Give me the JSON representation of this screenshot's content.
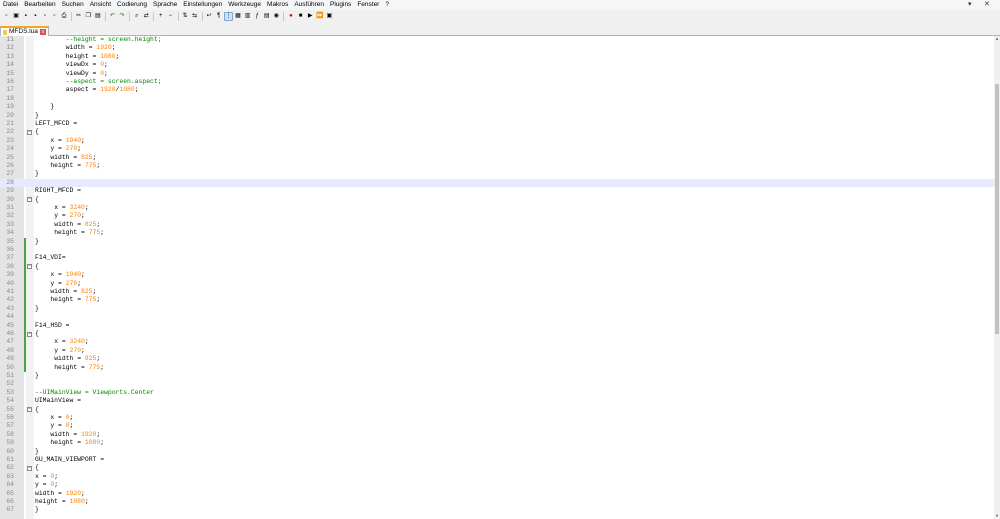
{
  "menu": [
    "Datei",
    "Bearbeiten",
    "Suchen",
    "Ansicht",
    "Codierung",
    "Sprache",
    "Einstellungen",
    "Werkzeuge",
    "Makros",
    "Ausführen",
    "Plugins",
    "Fenster",
    "?"
  ],
  "window_controls": {
    "pin": "▾",
    "close": "✕"
  },
  "toolbar": [
    {
      "name": "new-file-icon",
      "glyph": "▫"
    },
    {
      "name": "open-file-icon",
      "glyph": "▣"
    },
    {
      "name": "save-icon",
      "glyph": "▪"
    },
    {
      "name": "save-all-icon",
      "glyph": "▪"
    },
    {
      "name": "close-file-icon",
      "glyph": "▫"
    },
    {
      "name": "close-all-icon",
      "glyph": "▫"
    },
    {
      "name": "print-icon",
      "glyph": "⎙"
    },
    {
      "sep": true
    },
    {
      "name": "cut-icon",
      "glyph": "✂"
    },
    {
      "name": "copy-icon",
      "glyph": "❐"
    },
    {
      "name": "paste-icon",
      "glyph": "▤"
    },
    {
      "sep": true
    },
    {
      "name": "undo-icon",
      "glyph": "↶"
    },
    {
      "name": "redo-icon",
      "glyph": "↷"
    },
    {
      "sep": true
    },
    {
      "name": "find-icon",
      "glyph": "⌕"
    },
    {
      "name": "replace-icon",
      "glyph": "⇄"
    },
    {
      "sep": true
    },
    {
      "name": "zoom-in-icon",
      "glyph": "+"
    },
    {
      "name": "zoom-out-icon",
      "glyph": "−"
    },
    {
      "sep": true
    },
    {
      "name": "sync-vertical-icon",
      "glyph": "⇅"
    },
    {
      "name": "sync-horizontal-icon",
      "glyph": "⇆"
    },
    {
      "sep": true
    },
    {
      "name": "word-wrap-icon",
      "glyph": "↵"
    },
    {
      "name": "show-all-chars-icon",
      "glyph": "¶"
    },
    {
      "name": "indent-guide-icon",
      "glyph": "⋮",
      "active": true
    },
    {
      "name": "lang-define-icon",
      "glyph": "▦"
    },
    {
      "name": "doc-map-icon",
      "glyph": "▥"
    },
    {
      "name": "function-list-icon",
      "glyph": "ƒ"
    },
    {
      "name": "folder-workspace-icon",
      "glyph": "▤"
    },
    {
      "name": "monitoring-icon",
      "glyph": "◉"
    },
    {
      "sep": true
    },
    {
      "name": "record-macro-icon",
      "glyph": "●"
    },
    {
      "name": "stop-record-icon",
      "glyph": "■"
    },
    {
      "name": "play-macro-icon",
      "glyph": "▶"
    },
    {
      "name": "run-macro-multiple-icon",
      "glyph": "⏩"
    },
    {
      "name": "save-macro-icon",
      "glyph": "▣"
    }
  ],
  "colors": {
    "number": "#ff8000",
    "comment": "#008000",
    "change_marker": "#4aa34a",
    "current_line": "#e8e8ff"
  },
  "tab": {
    "label": "MFDS.lua",
    "close": "x"
  },
  "lines": [
    {
      "n": "11",
      "i": "        ",
      "t": [
        [
          "--height = screen.height;",
          "c"
        ]
      ]
    },
    {
      "n": "12",
      "i": "        ",
      "t": [
        [
          "width = ",
          "i"
        ],
        [
          "1920",
          "n"
        ],
        [
          ";",
          "i"
        ]
      ]
    },
    {
      "n": "13",
      "i": "        ",
      "t": [
        [
          "height = ",
          "i"
        ],
        [
          "1080",
          "n"
        ],
        [
          ";",
          "i"
        ]
      ]
    },
    {
      "n": "14",
      "i": "        ",
      "t": [
        [
          "viewDx = ",
          "i"
        ],
        [
          "0",
          "n"
        ],
        [
          ";",
          "i"
        ]
      ]
    },
    {
      "n": "15",
      "i": "        ",
      "t": [
        [
          "viewDy = ",
          "i"
        ],
        [
          "0",
          "n"
        ],
        [
          ";",
          "i"
        ]
      ]
    },
    {
      "n": "16",
      "i": "        ",
      "t": [
        [
          "--aspect = screen.aspect;",
          "c"
        ]
      ]
    },
    {
      "n": "17",
      "i": "        ",
      "t": [
        [
          "aspect = ",
          "i"
        ],
        [
          "1920",
          "n"
        ],
        [
          "/",
          "i"
        ],
        [
          "1080",
          "n"
        ],
        [
          ";",
          "i"
        ]
      ]
    },
    {
      "n": "18",
      "i": "",
      "t": []
    },
    {
      "n": "19",
      "i": "    ",
      "t": [
        [
          "}",
          "i"
        ]
      ]
    },
    {
      "n": "20",
      "i": "",
      "t": [
        [
          "}",
          "i"
        ]
      ]
    },
    {
      "n": "21",
      "i": "",
      "t": [
        [
          "LEFT_MFCD =",
          "i"
        ]
      ]
    },
    {
      "n": "22",
      "i": "",
      "t": [
        [
          "{",
          "i"
        ]
      ],
      "fold": true
    },
    {
      "n": "23",
      "i": "    ",
      "t": [
        [
          "x = ",
          "i"
        ],
        [
          "1940",
          "n"
        ],
        [
          ";",
          "i"
        ]
      ]
    },
    {
      "n": "24",
      "i": "    ",
      "t": [
        [
          "y = ",
          "i"
        ],
        [
          "270",
          "n"
        ],
        [
          ";",
          "i"
        ]
      ]
    },
    {
      "n": "25",
      "i": "    ",
      "t": [
        [
          "width = ",
          "i"
        ],
        [
          "825",
          "n"
        ],
        [
          ";",
          "i"
        ]
      ]
    },
    {
      "n": "26",
      "i": "    ",
      "t": [
        [
          "height = ",
          "i"
        ],
        [
          "775",
          "n"
        ],
        [
          ";",
          "i"
        ]
      ]
    },
    {
      "n": "27",
      "i": "",
      "t": [
        [
          "}",
          "i"
        ]
      ]
    },
    {
      "n": "28",
      "i": "",
      "t": [],
      "current": true
    },
    {
      "n": "29",
      "i": "",
      "t": [
        [
          "RIGHT_MFCD =",
          "i"
        ]
      ]
    },
    {
      "n": "30",
      "i": "",
      "t": [
        [
          "{",
          "i"
        ]
      ],
      "fold": true
    },
    {
      "n": "31",
      "i": "     ",
      "t": [
        [
          "x = ",
          "i"
        ],
        [
          "3240",
          "n"
        ],
        [
          ";",
          "i"
        ]
      ]
    },
    {
      "n": "32",
      "i": "     ",
      "t": [
        [
          "y = ",
          "i"
        ],
        [
          "270",
          "n"
        ],
        [
          ";",
          "i"
        ]
      ]
    },
    {
      "n": "33",
      "i": "     ",
      "t": [
        [
          "width = ",
          "i"
        ],
        [
          "825",
          "n"
        ],
        [
          ";",
          "i"
        ]
      ]
    },
    {
      "n": "34",
      "i": "     ",
      "t": [
        [
          "height = ",
          "i"
        ],
        [
          "775",
          "n"
        ],
        [
          ";",
          "i"
        ]
      ]
    },
    {
      "n": "35",
      "i": "",
      "t": [
        [
          "}",
          "i"
        ]
      ],
      "chg": true
    },
    {
      "n": "36",
      "i": "",
      "t": [],
      "chg": true
    },
    {
      "n": "37",
      "i": "",
      "t": [
        [
          "F14_VDI=",
          "i"
        ]
      ],
      "chg": true
    },
    {
      "n": "38",
      "i": "",
      "t": [
        [
          "{",
          "i"
        ]
      ],
      "fold": true,
      "chg": true
    },
    {
      "n": "39",
      "i": "    ",
      "t": [
        [
          "x = ",
          "i"
        ],
        [
          "1940",
          "n"
        ],
        [
          ";",
          "i"
        ]
      ],
      "chg": true
    },
    {
      "n": "40",
      "i": "    ",
      "t": [
        [
          "y = ",
          "i"
        ],
        [
          "270",
          "n"
        ],
        [
          ";",
          "i"
        ]
      ],
      "chg": true
    },
    {
      "n": "41",
      "i": "    ",
      "t": [
        [
          "width = ",
          "i"
        ],
        [
          "825",
          "n"
        ],
        [
          ";",
          "i"
        ]
      ],
      "chg": true
    },
    {
      "n": "42",
      "i": "    ",
      "t": [
        [
          "height = ",
          "i"
        ],
        [
          "775",
          "n"
        ],
        [
          ";",
          "i"
        ]
      ],
      "chg": true
    },
    {
      "n": "43",
      "i": "",
      "t": [
        [
          "}",
          "i"
        ]
      ],
      "chg": true
    },
    {
      "n": "44",
      "i": "",
      "t": [],
      "chg": true
    },
    {
      "n": "45",
      "i": "",
      "t": [
        [
          "F14_HSD =",
          "i"
        ]
      ],
      "chg": true
    },
    {
      "n": "46",
      "i": "",
      "t": [
        [
          "{",
          "i"
        ]
      ],
      "fold": true,
      "chg": true
    },
    {
      "n": "47",
      "i": "     ",
      "t": [
        [
          "x = ",
          "i"
        ],
        [
          "3240",
          "n"
        ],
        [
          ";",
          "i"
        ]
      ],
      "chg": true
    },
    {
      "n": "48",
      "i": "     ",
      "t": [
        [
          "y = ",
          "i"
        ],
        [
          "270",
          "n"
        ],
        [
          ";",
          "i"
        ]
      ],
      "chg": true
    },
    {
      "n": "49",
      "i": "     ",
      "t": [
        [
          "width = ",
          "i"
        ],
        [
          "825",
          "n"
        ],
        [
          ";",
          "i"
        ]
      ],
      "chg": true
    },
    {
      "n": "50",
      "i": "     ",
      "t": [
        [
          "height = ",
          "i"
        ],
        [
          "775",
          "n"
        ],
        [
          ";",
          "i"
        ]
      ],
      "chg": true
    },
    {
      "n": "51",
      "i": "",
      "t": [
        [
          "}",
          "i"
        ]
      ]
    },
    {
      "n": "52",
      "i": "",
      "t": []
    },
    {
      "n": "53",
      "i": "",
      "t": [
        [
          "--UIMainView = Viewports.Center",
          "c"
        ]
      ]
    },
    {
      "n": "54",
      "i": "",
      "t": [
        [
          "UIMainView =",
          "i"
        ]
      ]
    },
    {
      "n": "55",
      "i": "",
      "t": [
        [
          "{",
          "i"
        ]
      ],
      "fold": true
    },
    {
      "n": "56",
      "i": "    ",
      "t": [
        [
          "x = ",
          "i"
        ],
        [
          "0",
          "n"
        ],
        [
          ";",
          "i"
        ]
      ]
    },
    {
      "n": "57",
      "i": "    ",
      "t": [
        [
          "y = ",
          "i"
        ],
        [
          "0",
          "n"
        ],
        [
          ";",
          "i"
        ]
      ]
    },
    {
      "n": "58",
      "i": "    ",
      "t": [
        [
          "width = ",
          "i"
        ],
        [
          "1920",
          "n"
        ],
        [
          ";",
          "i"
        ]
      ]
    },
    {
      "n": "59",
      "i": "    ",
      "t": [
        [
          "height = ",
          "i"
        ],
        [
          "1080",
          "n"
        ],
        [
          ";",
          "i"
        ]
      ]
    },
    {
      "n": "60",
      "i": "",
      "t": [
        [
          "}",
          "i"
        ]
      ]
    },
    {
      "n": "61",
      "i": "",
      "t": [
        [
          "GU_MAIN_VIEWPORT =",
          "i"
        ]
      ]
    },
    {
      "n": "62",
      "i": "",
      "t": [
        [
          "{",
          "i"
        ]
      ],
      "fold": true
    },
    {
      "n": "63",
      "i": "",
      "t": [
        [
          "x = ",
          "i"
        ],
        [
          "0",
          "n"
        ],
        [
          ";",
          "i"
        ]
      ]
    },
    {
      "n": "64",
      "i": "",
      "t": [
        [
          "y = ",
          "i"
        ],
        [
          "0",
          "n"
        ],
        [
          ";",
          "i"
        ]
      ]
    },
    {
      "n": "65",
      "i": "",
      "t": [
        [
          "width = ",
          "i"
        ],
        [
          "1920",
          "n"
        ],
        [
          ";",
          "i"
        ]
      ]
    },
    {
      "n": "66",
      "i": "",
      "t": [
        [
          "height = ",
          "i"
        ],
        [
          "1080",
          "n"
        ],
        [
          ";",
          "i"
        ]
      ]
    },
    {
      "n": "67",
      "i": "",
      "t": [
        [
          "}",
          "i"
        ]
      ]
    }
  ]
}
